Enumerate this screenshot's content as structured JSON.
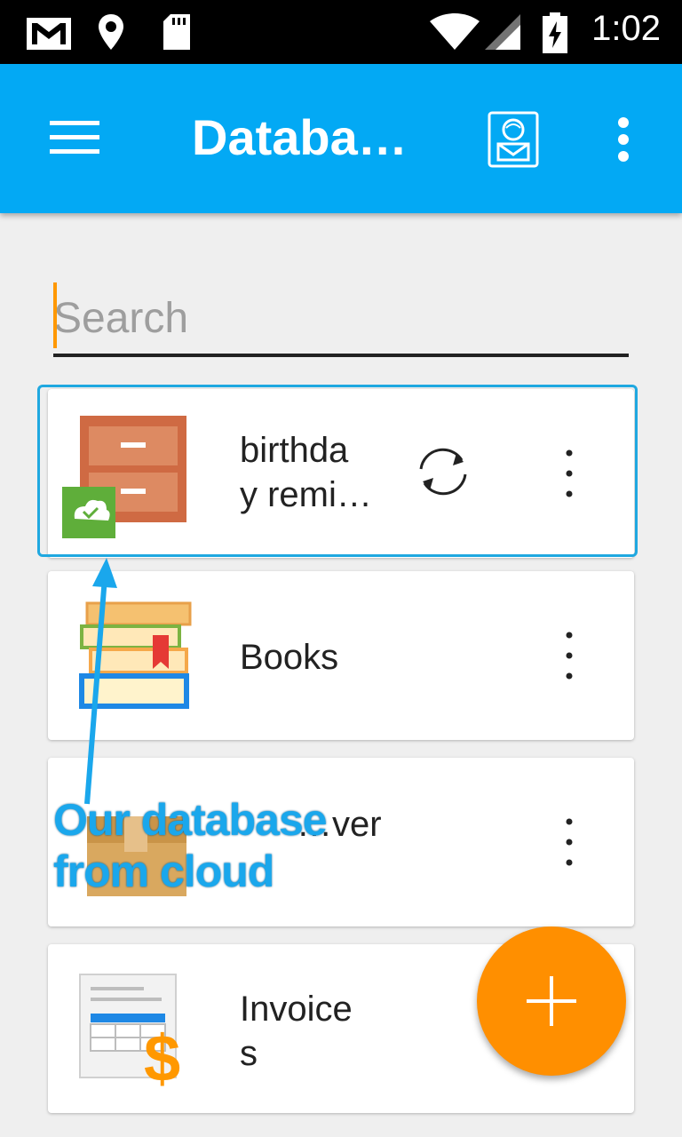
{
  "status_bar": {
    "time": "1:02",
    "icons": [
      "gmail-icon",
      "location-icon",
      "sd-card-icon",
      "wifi-icon",
      "signal-icon",
      "battery-charging-icon"
    ]
  },
  "app_bar": {
    "title": "Databas…",
    "icons": [
      "hamburger-menu-icon",
      "contact-card-icon",
      "overflow-menu-icon"
    ],
    "color": "#03a9f4"
  },
  "search": {
    "placeholder": "Search",
    "value": ""
  },
  "databases": [
    {
      "name_line1": "birthda",
      "name_line2": "y remi…",
      "icon": "cabinet-cloud-icon",
      "synced": true
    },
    {
      "name": "Books",
      "icon": "books-icon"
    },
    {
      "name": "…ver",
      "icon": "box-icon"
    },
    {
      "name_line1": "Invoice",
      "name_line2": "s",
      "icon": "invoice-icon"
    }
  ],
  "annotation": {
    "line1": "Our database",
    "line2": "from cloud"
  },
  "fab": {
    "icon": "plus-icon",
    "color": "#ff8f00"
  }
}
